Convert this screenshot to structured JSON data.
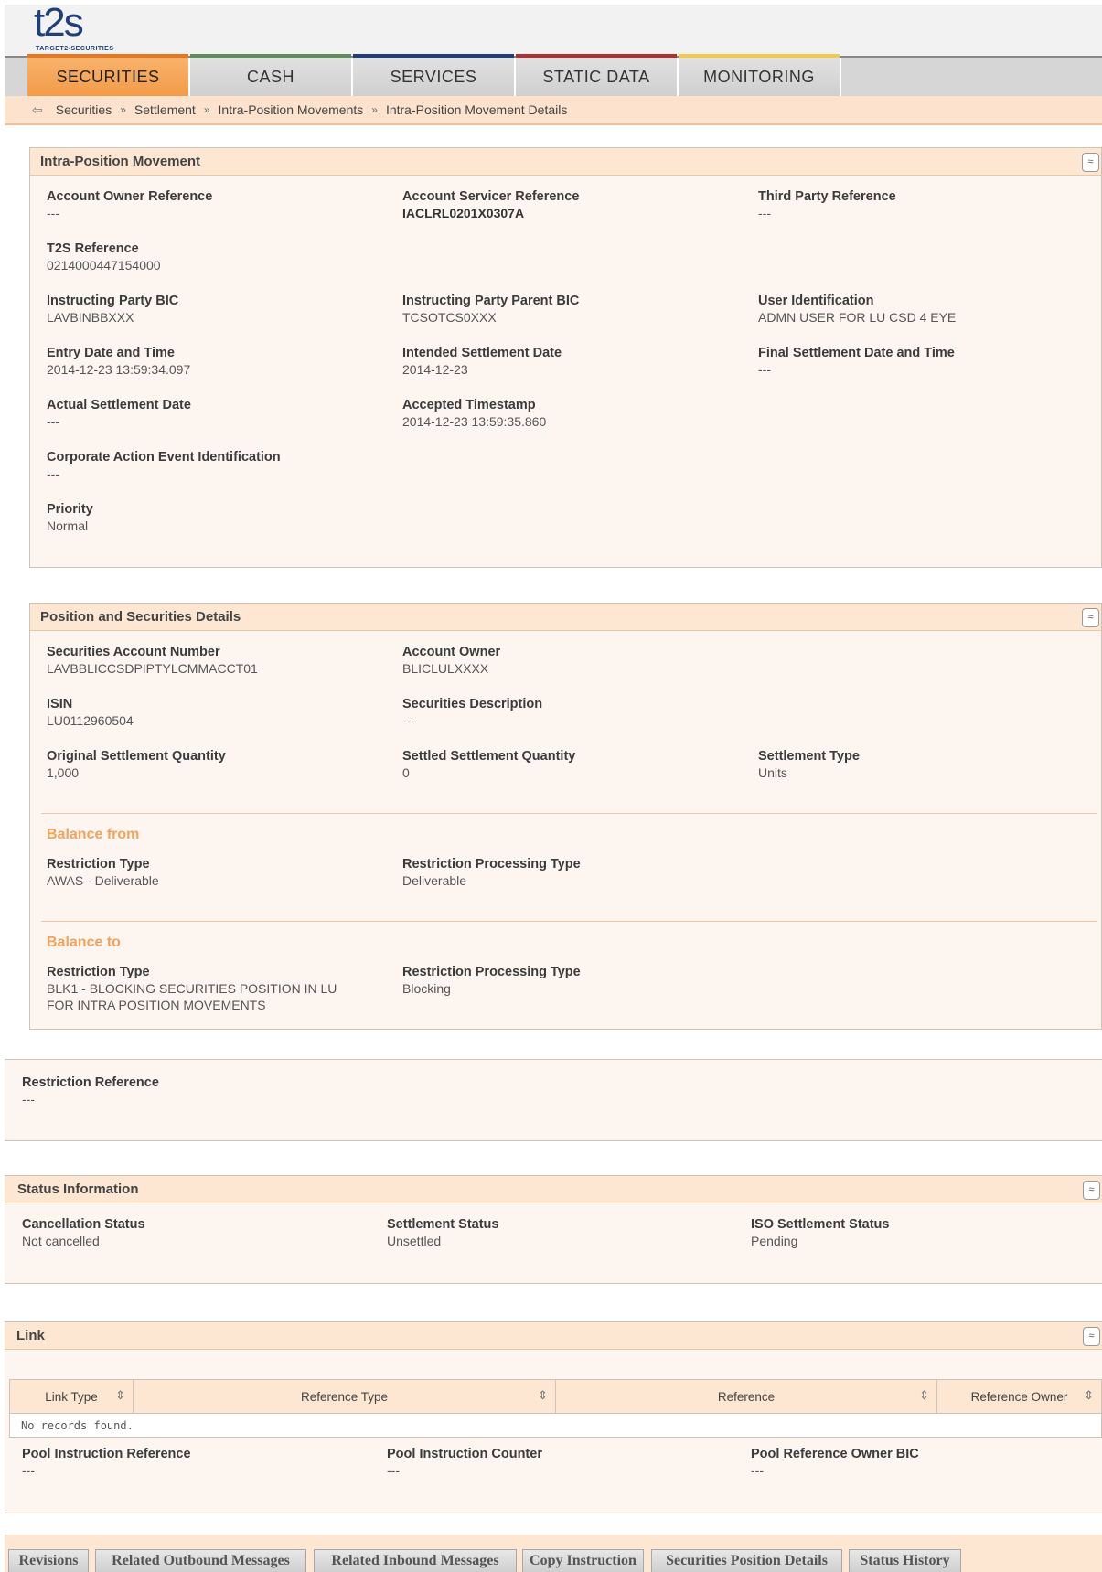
{
  "logo": {
    "main": "t2s",
    "sub": "TARGET2-SECURITIES"
  },
  "nav": [
    {
      "label": "SECURITIES",
      "active": true,
      "bar": "#e87722"
    },
    {
      "label": "CASH",
      "active": false,
      "bar": "#5e8e5e"
    },
    {
      "label": "SERVICES",
      "active": false,
      "bar": "#1f3f7a"
    },
    {
      "label": "STATIC DATA",
      "active": false,
      "bar": "#b03030"
    },
    {
      "label": "MONITORING",
      "active": false,
      "bar": "#f2c94c"
    }
  ],
  "breadcrumb": {
    "back_icon": "back-arrow-icon",
    "items": [
      "Securities",
      "Settlement",
      "Intra-Position Movements",
      "Intra-Position Movement Details"
    ],
    "separator": "»"
  },
  "collapse_glyph": "≈",
  "intra": {
    "title": "Intra-Position Movement",
    "account_owner_reference": {
      "label": "Account Owner Reference",
      "value": "---"
    },
    "account_servicer_reference": {
      "label": "Account Servicer Reference",
      "value": "IACLRL0201X0307A"
    },
    "third_party_reference": {
      "label": "Third Party Reference",
      "value": "---"
    },
    "t2s_reference": {
      "label": "T2S Reference",
      "value": "0214000447154000"
    },
    "instructing_party_bic": {
      "label": "Instructing Party BIC",
      "value": "LAVBINBBXXX"
    },
    "instructing_party_parent_bic": {
      "label": "Instructing Party Parent BIC",
      "value": "TCSOTCS0XXX"
    },
    "user_identification": {
      "label": "User Identification",
      "value": "ADMN USER FOR LU CSD 4 EYE"
    },
    "entry_date_time": {
      "label": "Entry Date and Time",
      "value": "2014-12-23 13:59:34.097"
    },
    "intended_settlement_date": {
      "label": "Intended Settlement Date",
      "value": "2014-12-23"
    },
    "final_settlement_date_time": {
      "label": "Final Settlement Date and Time",
      "value": "---"
    },
    "actual_settlement_date": {
      "label": "Actual Settlement Date",
      "value": "---"
    },
    "accepted_timestamp": {
      "label": "Accepted Timestamp",
      "value": "2014-12-23 13:59:35.860"
    },
    "corporate_action_event_id": {
      "label": "Corporate Action Event Identification",
      "value": "---"
    },
    "priority": {
      "label": "Priority",
      "value": "Normal"
    }
  },
  "position": {
    "title": "Position and Securities Details",
    "securities_account_number": {
      "label": "Securities Account Number",
      "value": "LAVBBLICCSDPIPTYLCMMACCT01"
    },
    "account_owner": {
      "label": "Account Owner",
      "value": "BLICLULXXXX"
    },
    "isin": {
      "label": "ISIN",
      "value": "LU0112960504"
    },
    "securities_description": {
      "label": "Securities Description",
      "value": "---"
    },
    "original_settlement_quantity": {
      "label": "Original Settlement Quantity",
      "value": "1,000"
    },
    "settled_settlement_quantity": {
      "label": "Settled Settlement Quantity",
      "value": "0"
    },
    "settlement_type": {
      "label": "Settlement Type",
      "value": "Units"
    },
    "balance_from": {
      "title": "Balance from",
      "restriction_type": {
        "label": "Restriction Type",
        "value": "AWAS - Deliverable"
      },
      "restriction_processing_type": {
        "label": "Restriction Processing Type",
        "value": "Deliverable"
      }
    },
    "balance_to": {
      "title": "Balance to",
      "restriction_type": {
        "label": "Restriction Type",
        "value_line1": "BLK1 - BLOCKING SECURITIES POSITION IN LU",
        "value_line2": "FOR INTRA POSITION MOVEMENTS"
      },
      "restriction_processing_type": {
        "label": "Restriction Processing Type",
        "value": "Blocking"
      }
    }
  },
  "restriction_reference": {
    "label": "Restriction Reference",
    "value": "---"
  },
  "status": {
    "title": "Status Information",
    "cancellation_status": {
      "label": "Cancellation Status",
      "value": "Not cancelled"
    },
    "settlement_status": {
      "label": "Settlement Status",
      "value": "Unsettled"
    },
    "iso_settlement_status": {
      "label": "ISO Settlement Status",
      "value": "Pending"
    }
  },
  "link": {
    "title": "Link",
    "columns": [
      "Link Type",
      "Reference Type",
      "Reference",
      "Reference Owner"
    ],
    "sort_glyph": "⇕",
    "empty_text": "No records found.",
    "pool_instruction_reference": {
      "label": "Pool Instruction Reference",
      "value": "---"
    },
    "pool_instruction_counter": {
      "label": "Pool Instruction Counter",
      "value": "---"
    },
    "pool_reference_owner_bic": {
      "label": "Pool Reference Owner BIC",
      "value": "---"
    }
  },
  "buttons": [
    "Revisions",
    "Related Outbound Messages",
    "Related Inbound Messages",
    "Copy Instruction",
    "Securities Position Details",
    "Status History"
  ]
}
